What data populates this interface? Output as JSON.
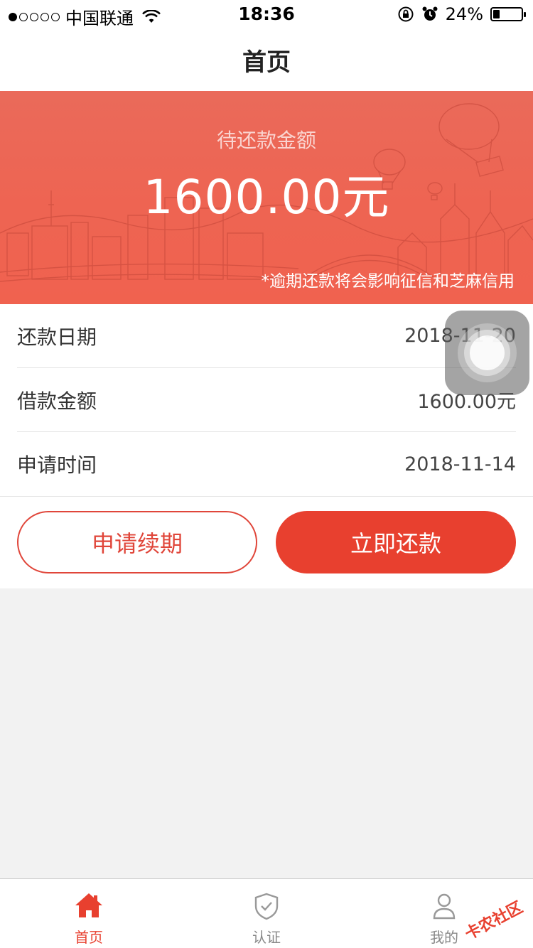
{
  "status_bar": {
    "carrier": "中国联通",
    "time": "18:36",
    "battery_percent": "24%",
    "battery_level": 0.24
  },
  "nav": {
    "title": "首页"
  },
  "banner": {
    "label": "待还款金额",
    "amount": "1600.00元",
    "note": "*逾期还款将会影响征信和芝麻信用"
  },
  "info": {
    "rows": [
      {
        "label": "还款日期",
        "value": "2018-11-20"
      },
      {
        "label": "借款金额",
        "value": "1600.00元"
      },
      {
        "label": "申请时间",
        "value": "2018-11-14"
      }
    ]
  },
  "actions": {
    "extend_label": "申请续期",
    "repay_label": "立即还款"
  },
  "tabs": [
    {
      "label": "首页",
      "icon": "home-icon",
      "active": true
    },
    {
      "label": "认证",
      "icon": "shield-check-icon",
      "active": false
    },
    {
      "label": "我的",
      "icon": "person-icon",
      "active": false
    }
  ],
  "watermark": "卡农社区",
  "colors": {
    "accent": "#e8402f",
    "banner": "#ee6452"
  }
}
